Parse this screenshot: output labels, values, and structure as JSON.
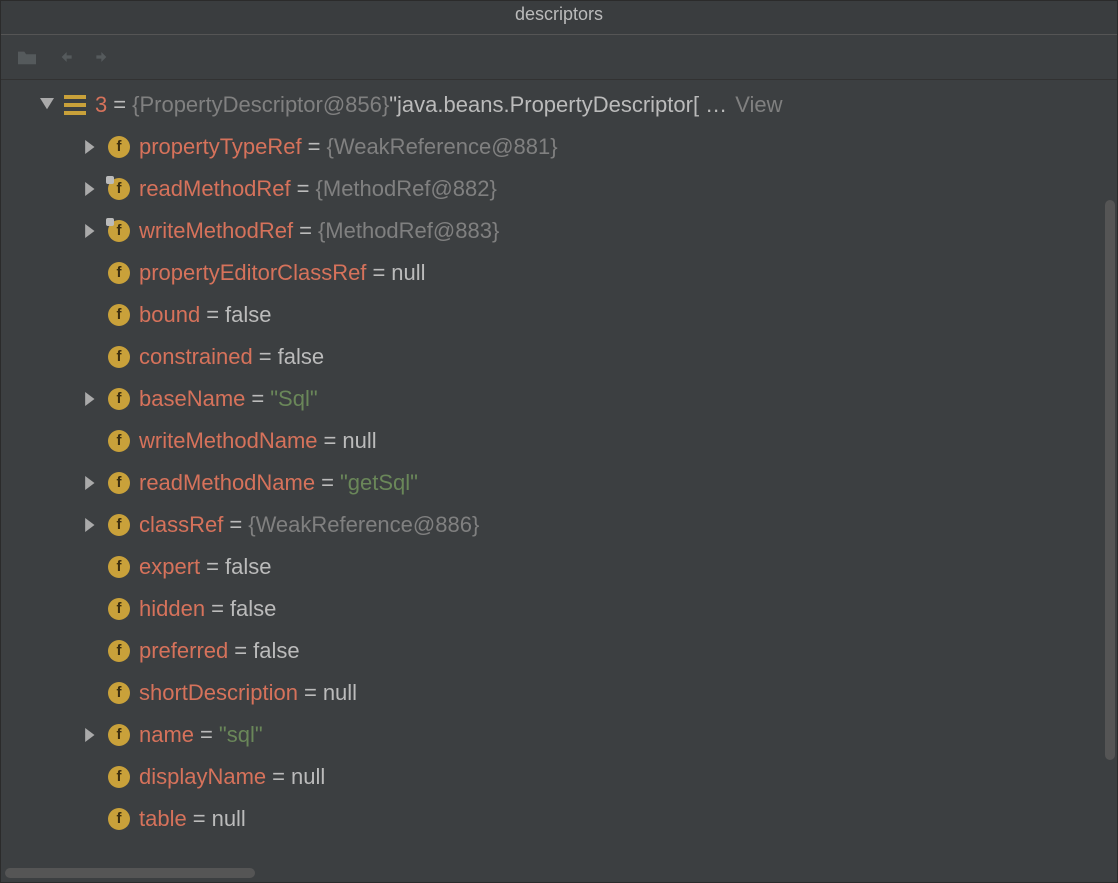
{
  "window": {
    "title": "descriptors"
  },
  "toolbar": {
    "folder_icon": "folder-icon",
    "back_icon": "arrow-left-icon",
    "forward_icon": "arrow-right-icon"
  },
  "root": {
    "index": "3",
    "equals": " = ",
    "type": "{PropertyDescriptor@856}",
    "desc": " \"java.beans.PropertyDescriptor[ …",
    "view": "View"
  },
  "fields": [
    {
      "name": "propertyTypeRef",
      "value": "{WeakReference@881}",
      "valClass": "val-grey",
      "expandable": true,
      "mark": false
    },
    {
      "name": "readMethodRef",
      "value": "{MethodRef@882}",
      "valClass": "val-grey",
      "expandable": true,
      "mark": true
    },
    {
      "name": "writeMethodRef",
      "value": "{MethodRef@883}",
      "valClass": "val-grey",
      "expandable": true,
      "mark": true
    },
    {
      "name": "propertyEditorClassRef",
      "value": "null",
      "valClass": "val-light",
      "expandable": false,
      "mark": false
    },
    {
      "name": "bound",
      "value": "false",
      "valClass": "val-light",
      "expandable": false,
      "mark": false
    },
    {
      "name": "constrained",
      "value": "false",
      "valClass": "val-light",
      "expandable": false,
      "mark": false
    },
    {
      "name": "baseName",
      "value": "\"Sql\"",
      "valClass": "val-green",
      "expandable": true,
      "mark": false
    },
    {
      "name": "writeMethodName",
      "value": "null",
      "valClass": "val-light",
      "expandable": false,
      "mark": false
    },
    {
      "name": "readMethodName",
      "value": "\"getSql\"",
      "valClass": "val-green",
      "expandable": true,
      "mark": false
    },
    {
      "name": "classRef",
      "value": "{WeakReference@886}",
      "valClass": "val-grey",
      "expandable": true,
      "mark": false
    },
    {
      "name": "expert",
      "value": "false",
      "valClass": "val-light",
      "expandable": false,
      "mark": false
    },
    {
      "name": "hidden",
      "value": "false",
      "valClass": "val-light",
      "expandable": false,
      "mark": false
    },
    {
      "name": "preferred",
      "value": "false",
      "valClass": "val-light",
      "expandable": false,
      "mark": false
    },
    {
      "name": "shortDescription",
      "value": "null",
      "valClass": "val-light",
      "expandable": false,
      "mark": false
    },
    {
      "name": "name",
      "value": "\"sql\"",
      "valClass": "val-green",
      "expandable": true,
      "mark": false
    },
    {
      "name": "displayName",
      "value": "null",
      "valClass": "val-light",
      "expandable": false,
      "mark": false
    },
    {
      "name": "table",
      "value": "null",
      "valClass": "val-light",
      "expandable": false,
      "mark": false
    }
  ],
  "glyphs": {
    "f": "f",
    "eq": " = "
  }
}
